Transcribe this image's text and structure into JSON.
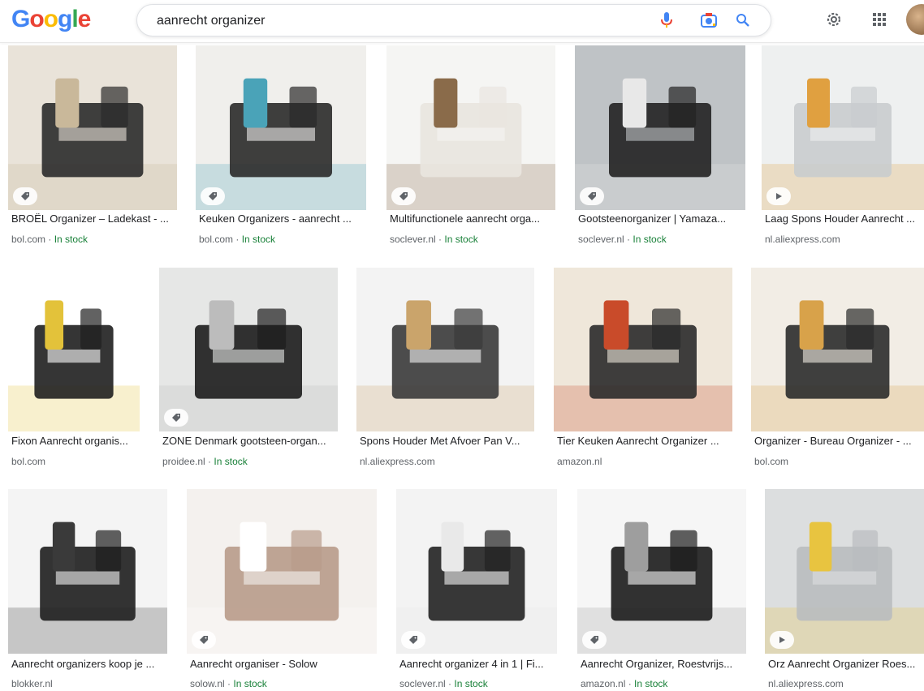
{
  "header": {
    "logo_letters": [
      "G",
      "o",
      "o",
      "g",
      "l",
      "e"
    ],
    "logo_colors": [
      "#4285F4",
      "#EA4335",
      "#FBBC05",
      "#4285F4",
      "#34A853",
      "#EA4335"
    ],
    "query": "aanrecht organizer",
    "icons": [
      "microphone-icon",
      "camera-lens-icon",
      "search-icon",
      "gear-icon",
      "apps-grid-icon",
      "avatar"
    ]
  },
  "results": [
    {
      "title": "BROËL Organizer – Ladekast - ...",
      "source": "bol.com",
      "stock": "In stock",
      "badge": "tag",
      "colors": [
        "#e9e3d9",
        "#2b2b2b",
        "#c9b89a"
      ]
    },
    {
      "title": "Keuken Organizers - aanrecht ...",
      "source": "bol.com",
      "stock": "In stock",
      "badge": "tag",
      "colors": [
        "#f0efec",
        "#2a2a2a",
        "#4aa3b8"
      ]
    },
    {
      "title": "Multifunctionele aanrecht orga...",
      "source": "soclever.nl",
      "stock": "In stock",
      "badge": "tag",
      "colors": [
        "#f5f5f3",
        "#e9e6df",
        "#8a6b4a"
      ]
    },
    {
      "title": "Gootsteenorganizer | Yamaza...",
      "source": "soclever.nl",
      "stock": "In stock",
      "badge": "tag",
      "colors": [
        "#bfc3c6",
        "#222222",
        "#e8e8e8"
      ]
    },
    {
      "title": "Laag Spons Houder Aanrecht ...",
      "source": "nl.aliexpress.com",
      "stock": "",
      "badge": "play",
      "colors": [
        "#eef0f0",
        "#c9ccce",
        "#e0a040"
      ]
    },
    {
      "title": "Fixon Aanrecht organis...",
      "source": "bol.com",
      "stock": "",
      "badge": "",
      "colors": [
        "#ffffff",
        "#1f1f1f",
        "#e3c23a"
      ]
    },
    {
      "title": "ZONE Denmark gootsteen-organ...",
      "source": "proidee.nl",
      "stock": "In stock",
      "badge": "tag",
      "colors": [
        "#e6e7e6",
        "#1c1c1c",
        "#bcbcbc"
      ]
    },
    {
      "title": "Spons Houder Met Afvoer Pan V...",
      "source": "nl.aliexpress.com",
      "stock": "",
      "badge": "",
      "colors": [
        "#f3f3f3",
        "#3a3a3a",
        "#caa46b"
      ]
    },
    {
      "title": "Tier Keuken Aanrecht Organizer ...",
      "source": "amazon.nl",
      "stock": "",
      "badge": "",
      "colors": [
        "#efe7da",
        "#2a2a2a",
        "#c94b2a"
      ]
    },
    {
      "title": "Organizer - Bureau Organizer - ...",
      "source": "bol.com",
      "stock": "",
      "badge": "",
      "colors": [
        "#f2ede5",
        "#2b2b2b",
        "#d8a24a"
      ]
    },
    {
      "title": "Aanrecht organizers koop je ...",
      "source": "blokker.nl",
      "stock": "",
      "badge": "",
      "colors": [
        "#f4f4f4",
        "#1e1e1e",
        "#3a3a3a"
      ]
    },
    {
      "title": "Aanrecht organiser - Solow",
      "source": "solow.nl",
      "stock": "In stock",
      "badge": "tag",
      "colors": [
        "#f4f1ee",
        "#b89b8a",
        "#ffffff"
      ]
    },
    {
      "title": "Aanrecht organizer 4 in 1 | Fi...",
      "source": "soclever.nl",
      "stock": "In stock",
      "badge": "tag",
      "colors": [
        "#f3f3f3",
        "#222222",
        "#e9e9e9"
      ]
    },
    {
      "title": "Aanrecht Organizer, Roestvrijs...",
      "source": "amazon.nl",
      "stock": "In stock",
      "badge": "tag",
      "colors": [
        "#f6f6f6",
        "#1c1c1c",
        "#9e9e9e"
      ]
    },
    {
      "title": "Orz Aanrecht Organizer Roes...",
      "source": "nl.aliexpress.com",
      "stock": "",
      "badge": "play",
      "colors": [
        "#dcdedf",
        "#b9bcbf",
        "#e8c440"
      ]
    }
  ]
}
